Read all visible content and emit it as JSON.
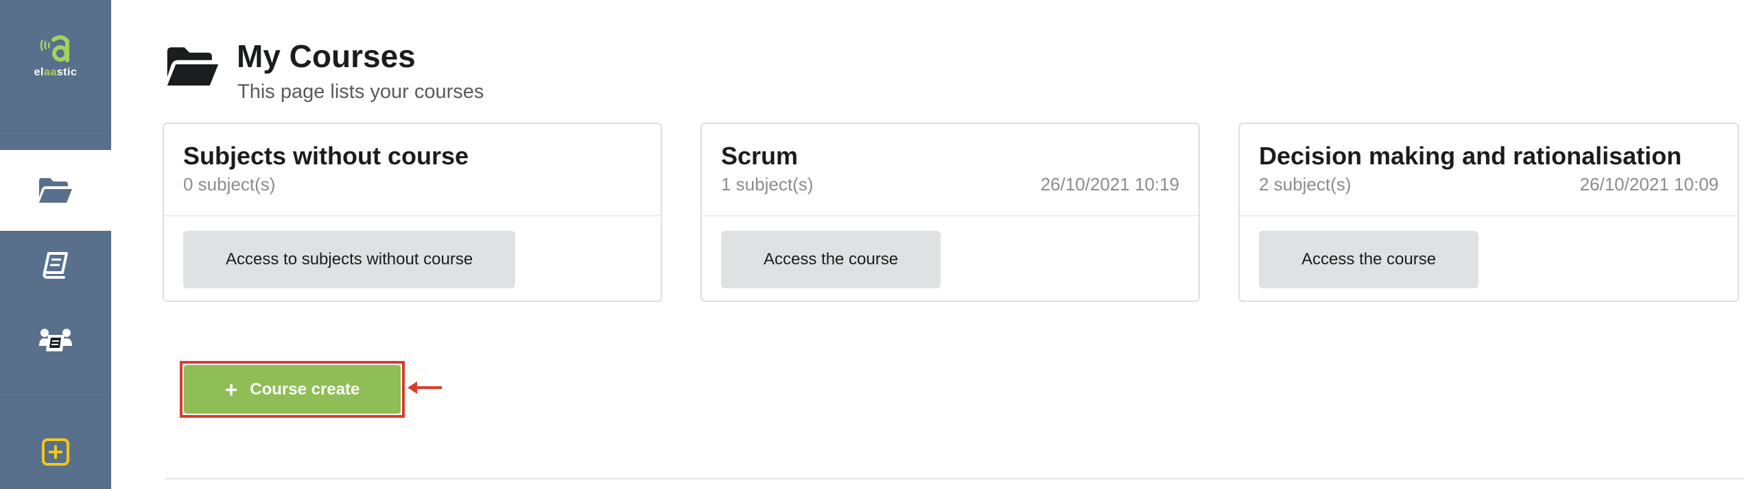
{
  "app": {
    "logo_text_pre": "el",
    "logo_text_accent": "aa",
    "logo_text_post": "stic"
  },
  "sidebar": {
    "items": [
      {
        "name": "courses",
        "icon": "folder-open-icon",
        "active": true
      },
      {
        "name": "subjects",
        "icon": "book-icon",
        "active": false
      },
      {
        "name": "groups",
        "icon": "users-icon",
        "active": false
      },
      {
        "name": "create",
        "icon": "plus-square-icon",
        "active": false
      }
    ]
  },
  "header": {
    "icon": "folder-open-icon",
    "title": "My Courses",
    "subtitle": "This page lists your courses"
  },
  "cards": [
    {
      "title": "Subjects without course",
      "count": "0 subject(s)",
      "date": "",
      "button": "Access to subjects without course"
    },
    {
      "title": "Scrum",
      "count": "1 subject(s)",
      "date": "26/10/2021 10:19",
      "button": "Access the course"
    },
    {
      "title": "Decision making and rationalisation",
      "count": "2 subject(s)",
      "date": "26/10/2021 10:09",
      "button": "Access the course"
    }
  ],
  "create_button": {
    "icon": "+",
    "label": "Course create"
  },
  "colors": {
    "sidebar": "#58708c",
    "accent_green": "#8fbd56",
    "highlight_red": "#dd3b2a"
  }
}
